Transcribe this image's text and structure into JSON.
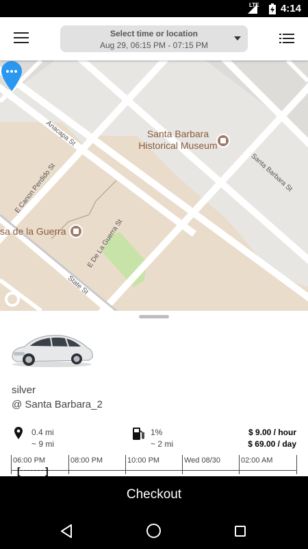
{
  "status_bar": {
    "time": "4:14",
    "network": "LTE"
  },
  "header": {
    "menu_icon": "hamburger-menu-icon",
    "title": "Select time or location",
    "subtitle": "Aug 29, 06:15 PM - 07:15 PM",
    "list_icon": "list-view-icon"
  },
  "map": {
    "streets": [
      "Anacapa St",
      "E Canon Perdido St",
      "E De La Guerra St",
      "State St",
      "Santa Barbara St"
    ],
    "pois": [
      {
        "label_line1": "Santa Barbara",
        "label_line2": "Historical Museum"
      },
      {
        "label_line1": "sa de la Guerra"
      }
    ],
    "pin_icon": "car-location-pin-icon",
    "pin_color": "#2a97f0"
  },
  "vehicle": {
    "color": "silver",
    "location": "@ Santa Barbara_2",
    "distance": "0.4 mi",
    "walk_time": "~ 9 mi",
    "fuel": "1%",
    "range": "~ 2 mi",
    "price_hour": "$ 9.00 / hour",
    "price_day": "$ 69.00 / day"
  },
  "timeline": {
    "labels": [
      "06:00 PM",
      "08:00 PM",
      "10:00 PM",
      "Wed 08/30",
      "02:00 AM"
    ]
  },
  "checkout": {
    "label": "Checkout"
  },
  "colors": {
    "accent": "#2a97f0",
    "dark": "#000000",
    "map_block": "#e9dccb"
  }
}
